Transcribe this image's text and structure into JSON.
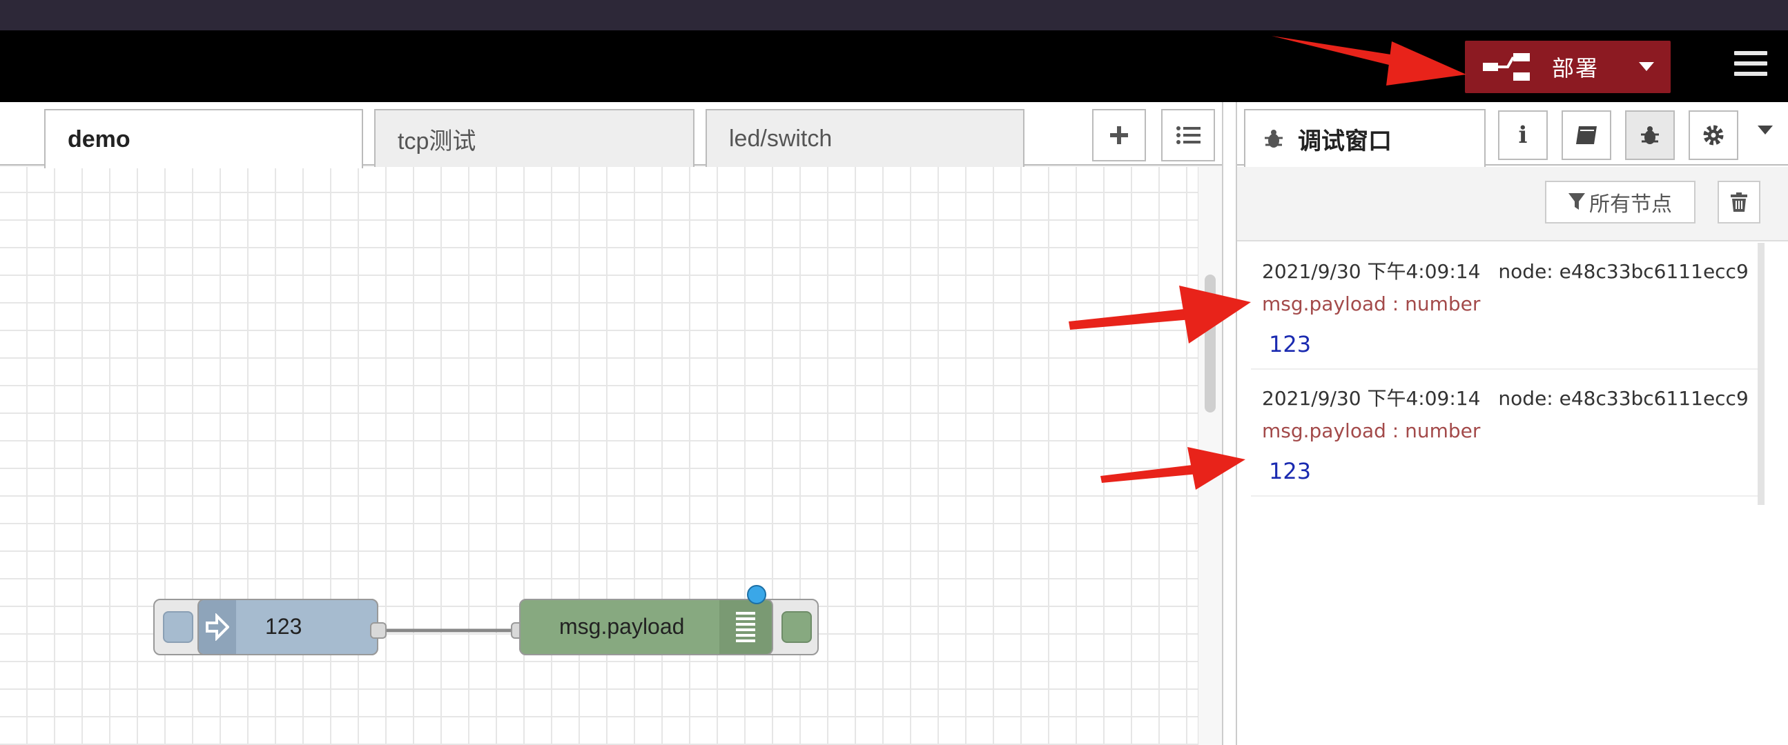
{
  "header": {
    "deploy_label": "部署"
  },
  "workspace": {
    "tabs": [
      {
        "label": "demo",
        "active": true
      },
      {
        "label": "tcp测试",
        "active": false
      },
      {
        "label": "led/switch",
        "active": false
      }
    ],
    "add_flow_icon": "plus-icon",
    "flow_list_icon": "list-icon"
  },
  "flow": {
    "inject_node": {
      "label": "123",
      "color": "#a6bbcf"
    },
    "debug_node": {
      "label": "msg.payload",
      "color": "#87a980"
    }
  },
  "sidebar": {
    "active_tab_label": "调试窗口",
    "filter_label": "所有节点",
    "tool_icons": [
      "info-icon",
      "book-icon",
      "bug-icon",
      "gear-icon"
    ],
    "messages": [
      {
        "timestamp": "2021/9/30 下午4:09:14",
        "node": "node: e48c33bc6111ecc9",
        "topic": "msg.payload : number",
        "value": "123"
      },
      {
        "timestamp": "2021/9/30 下午4:09:14",
        "node": "node: e48c33bc6111ecc9",
        "topic": "msg.payload : number",
        "value": "123"
      }
    ]
  },
  "colors": {
    "deploy_bg": "#8c1a22",
    "annotation_arrow": "#e8231a",
    "topic_text": "#a34a4a",
    "value_text": "#1a2ab0"
  }
}
